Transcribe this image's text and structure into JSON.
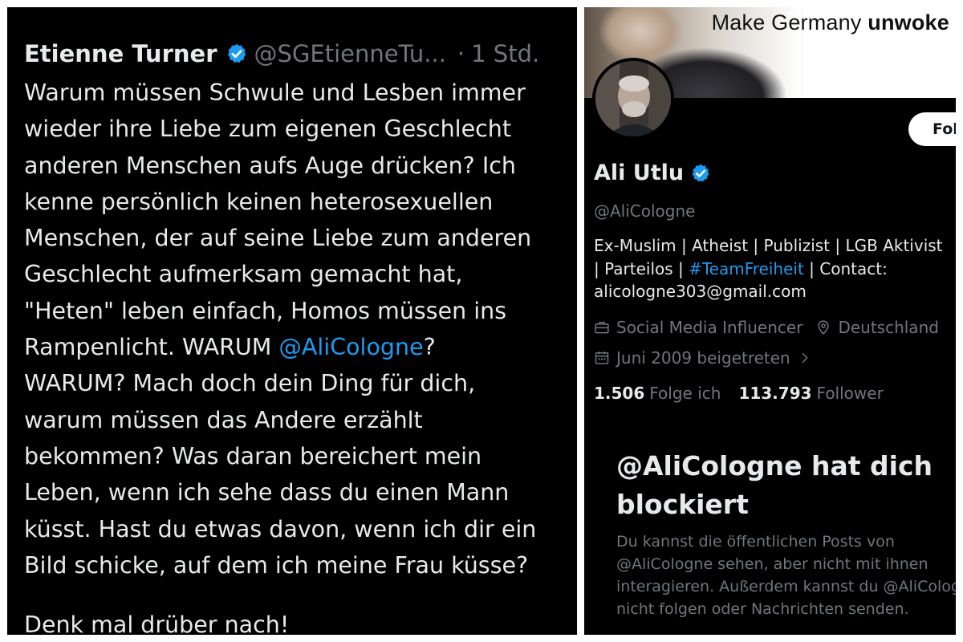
{
  "tweet": {
    "author_name": "Etienne Turner",
    "author_handle": "@SGEtienneTu...",
    "separator": "·",
    "time": "1 Std.",
    "lines": [
      "Warum müssen Schwule und Lesben immer",
      "wieder ihre Liebe zum eigenen Geschlecht",
      "anderen Menschen aufs Auge drücken? Ich",
      "kenne persönlich keinen heterosexuellen",
      "Menschen, der auf seine Liebe zum anderen",
      "Geschlecht aufmerksam gemacht hat,",
      "\"Heten\" leben einfach, Homos müssen ins"
    ],
    "line8_before": "Rampenlicht. WARUM ",
    "line8_mention": "@AliCologne",
    "line8_after": "?",
    "lines_rest": [
      "WARUM? Mach doch dein Ding für dich,",
      "warum müssen das Andere erzählt",
      "bekommen? Was daran bereichert mein",
      "Leben, wenn ich sehe dass du einen Mann",
      "küsst. Hast du etwas davon, wenn ich dir ein",
      "Bild schicke, auf dem ich meine Frau küsse?"
    ],
    "closing": "Denk mal drüber nach!"
  },
  "profile": {
    "banner_slogan_regular": "Make Germany ",
    "banner_slogan_bold": "unwoke",
    "follow_label": "Fol",
    "name": "Ali Utlu",
    "handle": "@AliCologne",
    "bio_line1": "Ex-Muslim | Atheist | Publizist | LGB Aktivist",
    "bio_line2_before": "| Parteilos | ",
    "bio_line2_hashtag": "#TeamFreiheit",
    "bio_line2_after": " | Contact:",
    "bio_line3": "alicologne303@gmail.com",
    "category": "Social Media Influencer",
    "location": "Deutschland",
    "joined": "Juni 2009 beigetreten",
    "following_count": "1.506",
    "following_label": "Folge ich",
    "followers_count": "113.793",
    "followers_label": "Follower"
  },
  "blocked": {
    "title_line1": "@AliCologne hat dich",
    "title_line2": "blockiert",
    "text_lines": [
      "Du kannst die öffentlichen Posts von",
      "@AliCologne sehen, aber nicht mit ihnen",
      "interagieren. Außerdem kannst du @AliCologne",
      "nicht folgen oder Nachrichten senden."
    ]
  },
  "icons": {
    "verified": "verified-badge-icon",
    "category": "briefcase-icon",
    "location": "location-pin-icon",
    "joined": "calendar-icon",
    "joined_more": "chevron-right-icon"
  },
  "colors": {
    "background": "#000000",
    "text_primary": "#e7e9ea",
    "text_secondary": "#71767b",
    "accent": "#1d9bf0"
  }
}
